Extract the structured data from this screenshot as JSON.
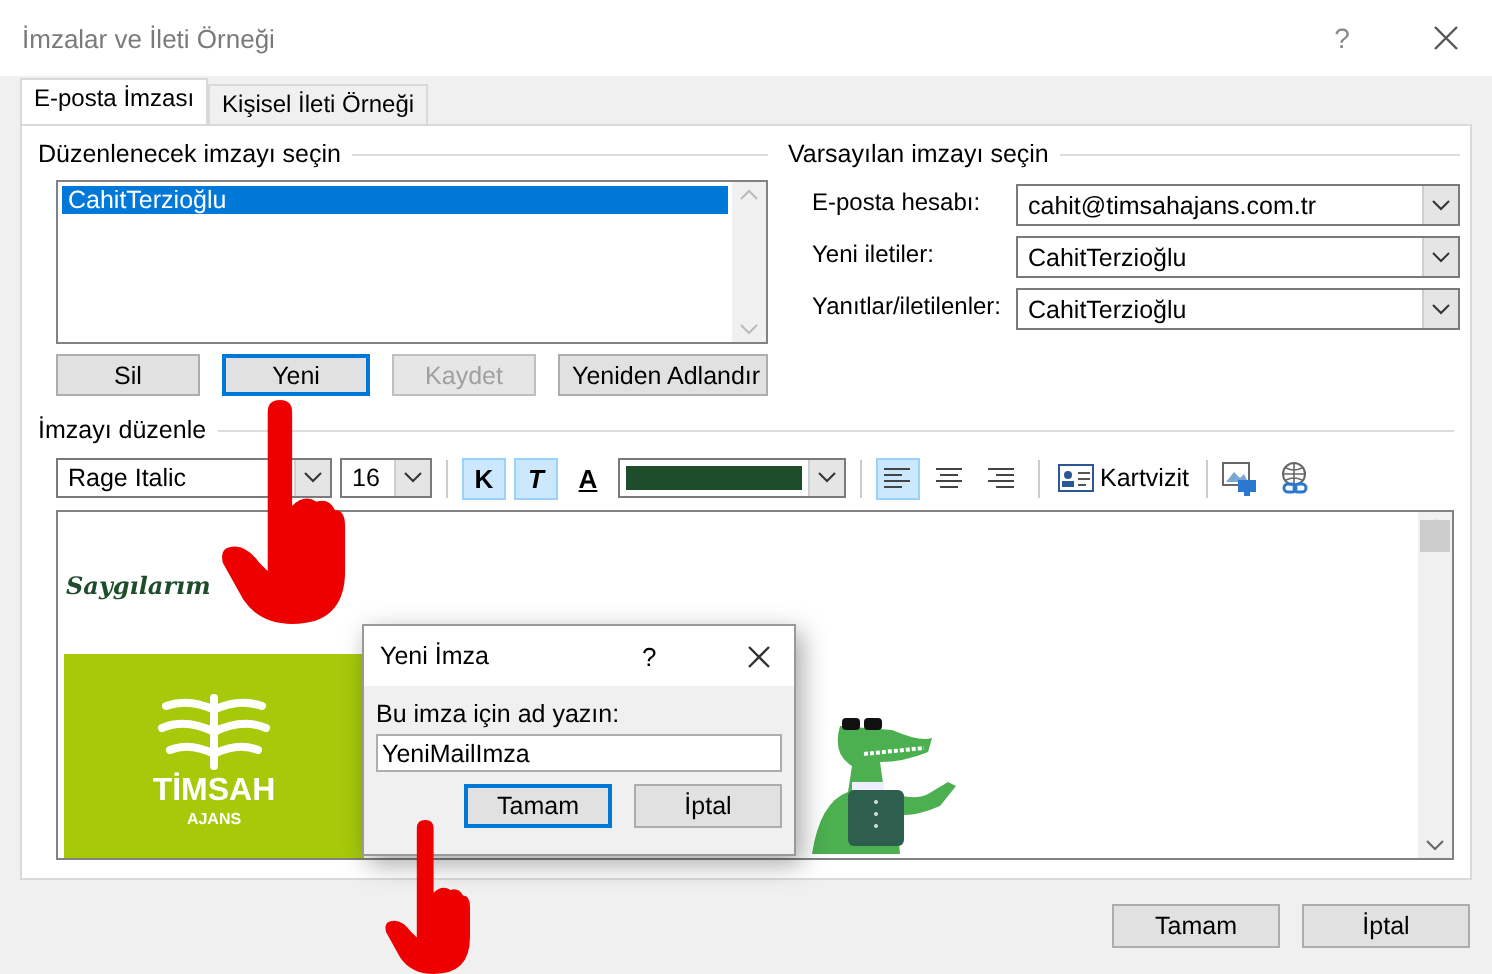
{
  "window": {
    "title": "İmzalar ve İleti Örneği",
    "help": "?"
  },
  "tabs": [
    {
      "label": "E-posta İmzası",
      "selected": true
    },
    {
      "label": "Kişisel İleti Örneği",
      "selected": false
    }
  ],
  "signature_list": {
    "heading": "Düzenlenecek imzayı seçin",
    "items": [
      {
        "label": "CahitTerzioğlu",
        "selected": true
      }
    ]
  },
  "list_buttons": [
    {
      "label": "Sil",
      "disabled": false,
      "focused": false
    },
    {
      "label": "Yeni",
      "disabled": false,
      "focused": true
    },
    {
      "label": "Kaydet",
      "disabled": true,
      "focused": false
    },
    {
      "label": "Yeniden Adlandır",
      "disabled": false,
      "focused": false
    }
  ],
  "defaults": {
    "heading": "Varsayılan imzayı seçin",
    "fields": [
      {
        "label": "E-posta hesabı:",
        "value": "cahit@timsahajans.com.tr"
      },
      {
        "label": "Yeni iletiler:",
        "value": "CahitTerzioğlu"
      },
      {
        "label": "Yanıtlar/iletilenler:",
        "value": "CahitTerzioğlu"
      }
    ]
  },
  "editor": {
    "heading": "İmzayı düzenle",
    "font": "Rage Italic",
    "size": "16",
    "format_buttons": [
      {
        "kind": "bold",
        "label": "K",
        "on": true
      },
      {
        "kind": "italic",
        "label": "T",
        "on": true
      },
      {
        "kind": "underline",
        "label": "A",
        "on": false
      }
    ],
    "font_color": {
      "color": "#1e4d2b"
    },
    "alignment": [
      {
        "kind": "left",
        "selected": true
      },
      {
        "kind": "center",
        "selected": false
      },
      {
        "kind": "right",
        "selected": false
      }
    ],
    "business_card": "Kartvizit",
    "content": {
      "greeting": "Saygılarım",
      "logo_name": "TİMSAH",
      "logo_sub": "AJANS"
    }
  },
  "new_signature_dialog": {
    "title": "Yeni İmza",
    "help": "?",
    "prompt": "Bu imza için ad yazın:",
    "value": "YeniMailImza",
    "buttons": [
      {
        "label": "Tamam",
        "focused": true
      },
      {
        "label": "İptal",
        "focused": false
      }
    ]
  },
  "footer_buttons": [
    "Tamam",
    "İptal"
  ]
}
